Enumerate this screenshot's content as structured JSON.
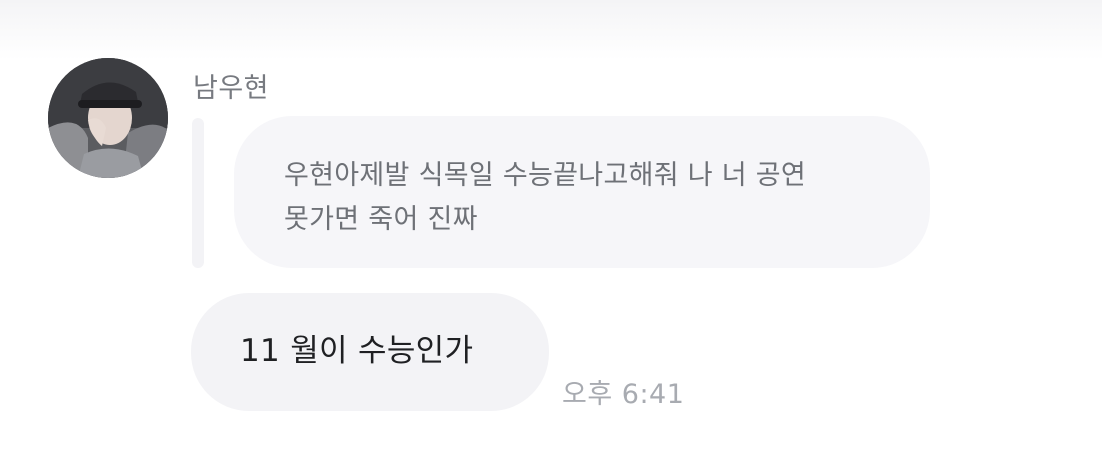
{
  "chat": {
    "sender_name": "남우현",
    "avatar_icon": "profile-photo",
    "quoted_message": "우현아제발 식목일 수능끝나고해줘 나 너 공연\n못가면 죽어 진짜",
    "reply_message": "11 월이 수능인가",
    "timestamp": "오후 6:41"
  },
  "colors": {
    "bubble": "#f3f3f6",
    "name": "#777a80",
    "quoted_text": "#6e7177",
    "reply_text": "#1f2023",
    "timestamp": "#a8abb1"
  }
}
